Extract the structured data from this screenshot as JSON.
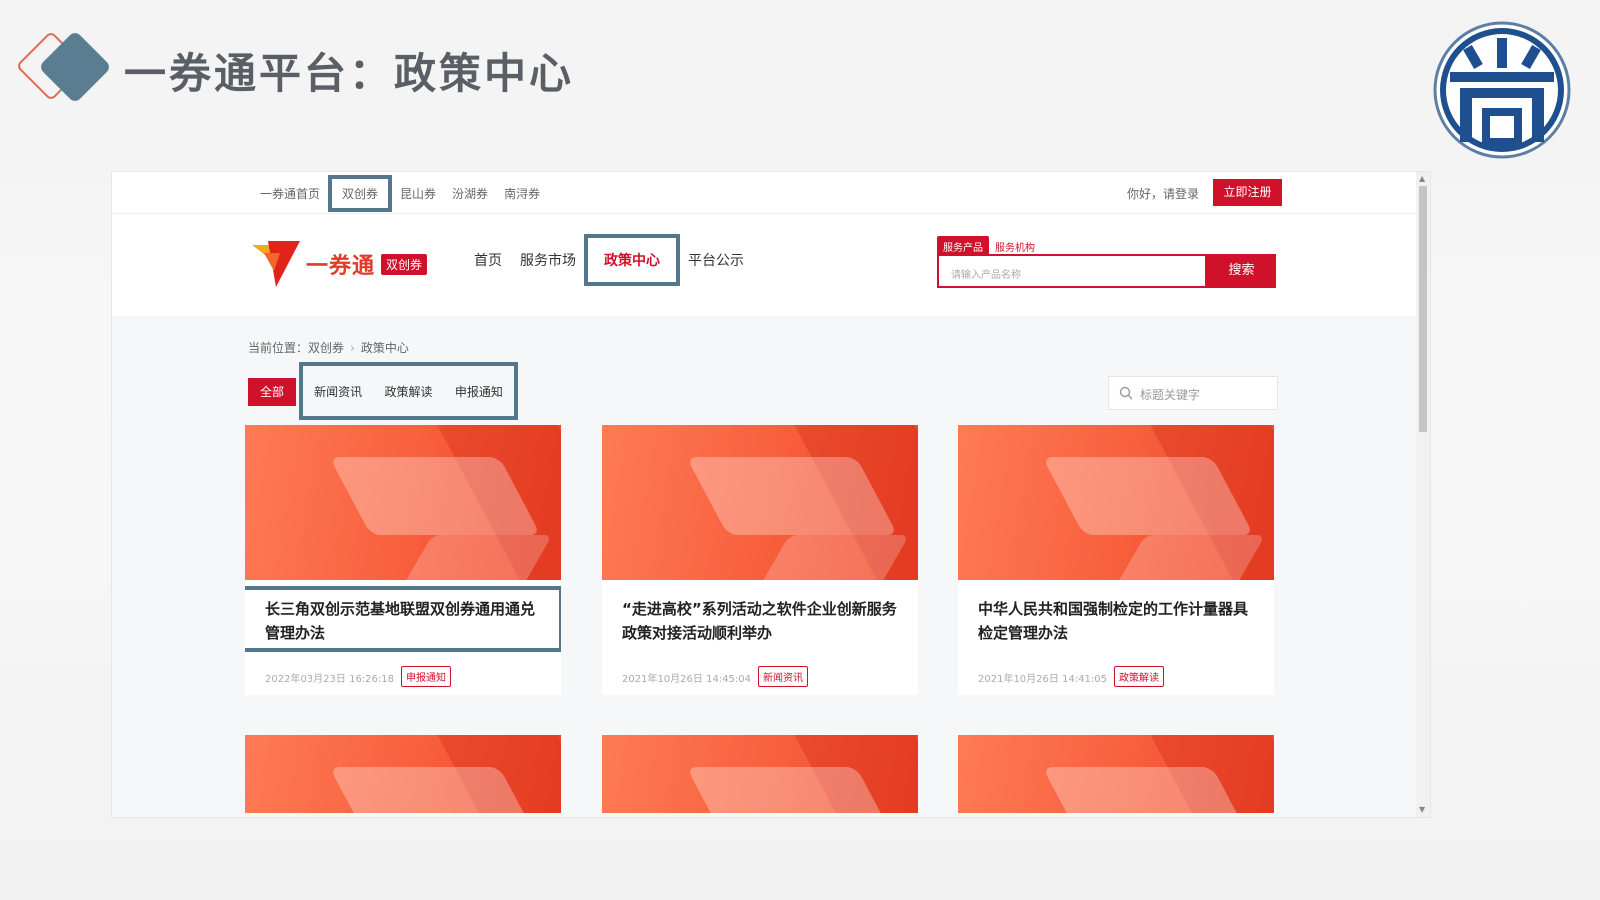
{
  "slide": {
    "title": "一券通平台：政策中心"
  },
  "topbar": {
    "items": [
      "一券通首页",
      "双创券",
      "昆山券",
      "汾湖券",
      "南浔券"
    ],
    "greeting": "你好，请登录",
    "register": "立即注册"
  },
  "header": {
    "brand_name": "一券通",
    "brand_tag": "双创券",
    "nav": [
      "首页",
      "服务市场",
      "政策中心",
      "平台公示"
    ],
    "search_tabs": [
      "服务产品",
      "服务机构"
    ],
    "search_placeholder": "请输入产品名称",
    "search_button": "搜索"
  },
  "breadcrumb": {
    "prefix": "当前位置：",
    "items": [
      "双创券",
      "政策中心"
    ]
  },
  "filters": {
    "all": "全部",
    "items": [
      "新闻资讯",
      "政策解读",
      "申报通知"
    ],
    "keyword_placeholder": "标题关键字"
  },
  "cards": [
    {
      "title": "长三角双创示范基地联盟双创券通用通兑管理办法",
      "date": "2022年03月23日 16:26:18",
      "tag": "申报通知"
    },
    {
      "title": "“走进高校”系列活动之软件企业创新服务政策对接活动顺利举办",
      "date": "2021年10月26日 14:45:04",
      "tag": "新闻资讯"
    },
    {
      "title": "中华人民共和国强制检定的工作计量器具检定管理办法",
      "date": "2021年10月26日 14:41:05",
      "tag": "政策解读"
    }
  ],
  "colors": {
    "accent_red": "#d0112b",
    "highlight_frame": "#53788c",
    "banner_orange": "#f75e3c"
  },
  "icons": [
    "diamond-icon",
    "seal-logo",
    "brand-v-logo",
    "search-icon"
  ]
}
